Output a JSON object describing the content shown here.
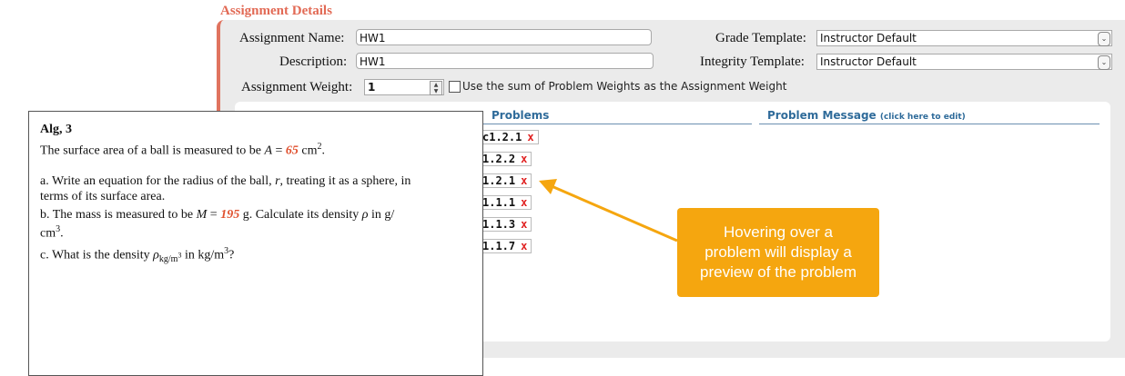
{
  "section": {
    "title": "Assignment Details"
  },
  "form": {
    "assignment_name_label": "Assignment Name:",
    "assignment_name_value": "HW1",
    "description_label": "Description:",
    "description_value": "HW1",
    "weight_label": "Assignment Weight:",
    "weight_value": "1",
    "use_sum_label": "Use the sum of Problem Weights as the Assignment Weight",
    "grade_template_label": "Grade Template:",
    "grade_template_value": "Instructor Default",
    "integrity_template_label": "Integrity Template:",
    "integrity_template_value": "Instructor Default"
  },
  "table": {
    "problems_header": "Problems",
    "message_header": "Problem Message",
    "message_hint": "(click here to edit)",
    "problems": [
      "c1.2.1",
      "1.2.2",
      "1.2.1",
      "1.1.1",
      "1.1.3",
      "1.1.7"
    ],
    "remove_label": "x"
  },
  "preview": {
    "title": "Alg, 3",
    "line1_pre": "The surface area of a ball is measured to be ",
    "var_A": "A",
    "eq": " = ",
    "val_A": "65",
    "unit_cm": " cm",
    "sup2": "2",
    "period": ".",
    "a_line1": "a. Write an equation for the radius of the ball, ",
    "var_r": "r",
    "a_line1_post": ", treating it as a sphere, in",
    "a_line2": "terms of its surface area.",
    "b_pre": "b. The mass is measured to be ",
    "var_M": "M",
    "val_M": "195",
    "b_post": " g. Calculate its density ",
    "rho": "ρ",
    "b_end": " in g/",
    "b_cont": "cm",
    "sup3": "3",
    "c_pre": "c. What is the density ",
    "c_sub": "kg/m",
    "c_mid": " in kg/m",
    "c_end": "?"
  },
  "callout": {
    "line1": "Hovering over a",
    "line2": "problem will display a",
    "line3": "preview of the problem"
  },
  "colors": {
    "accent": "#e0735f",
    "callout": "#f5a60f",
    "header_blue": "#2f6b9a",
    "remove_red": "#e02020"
  }
}
